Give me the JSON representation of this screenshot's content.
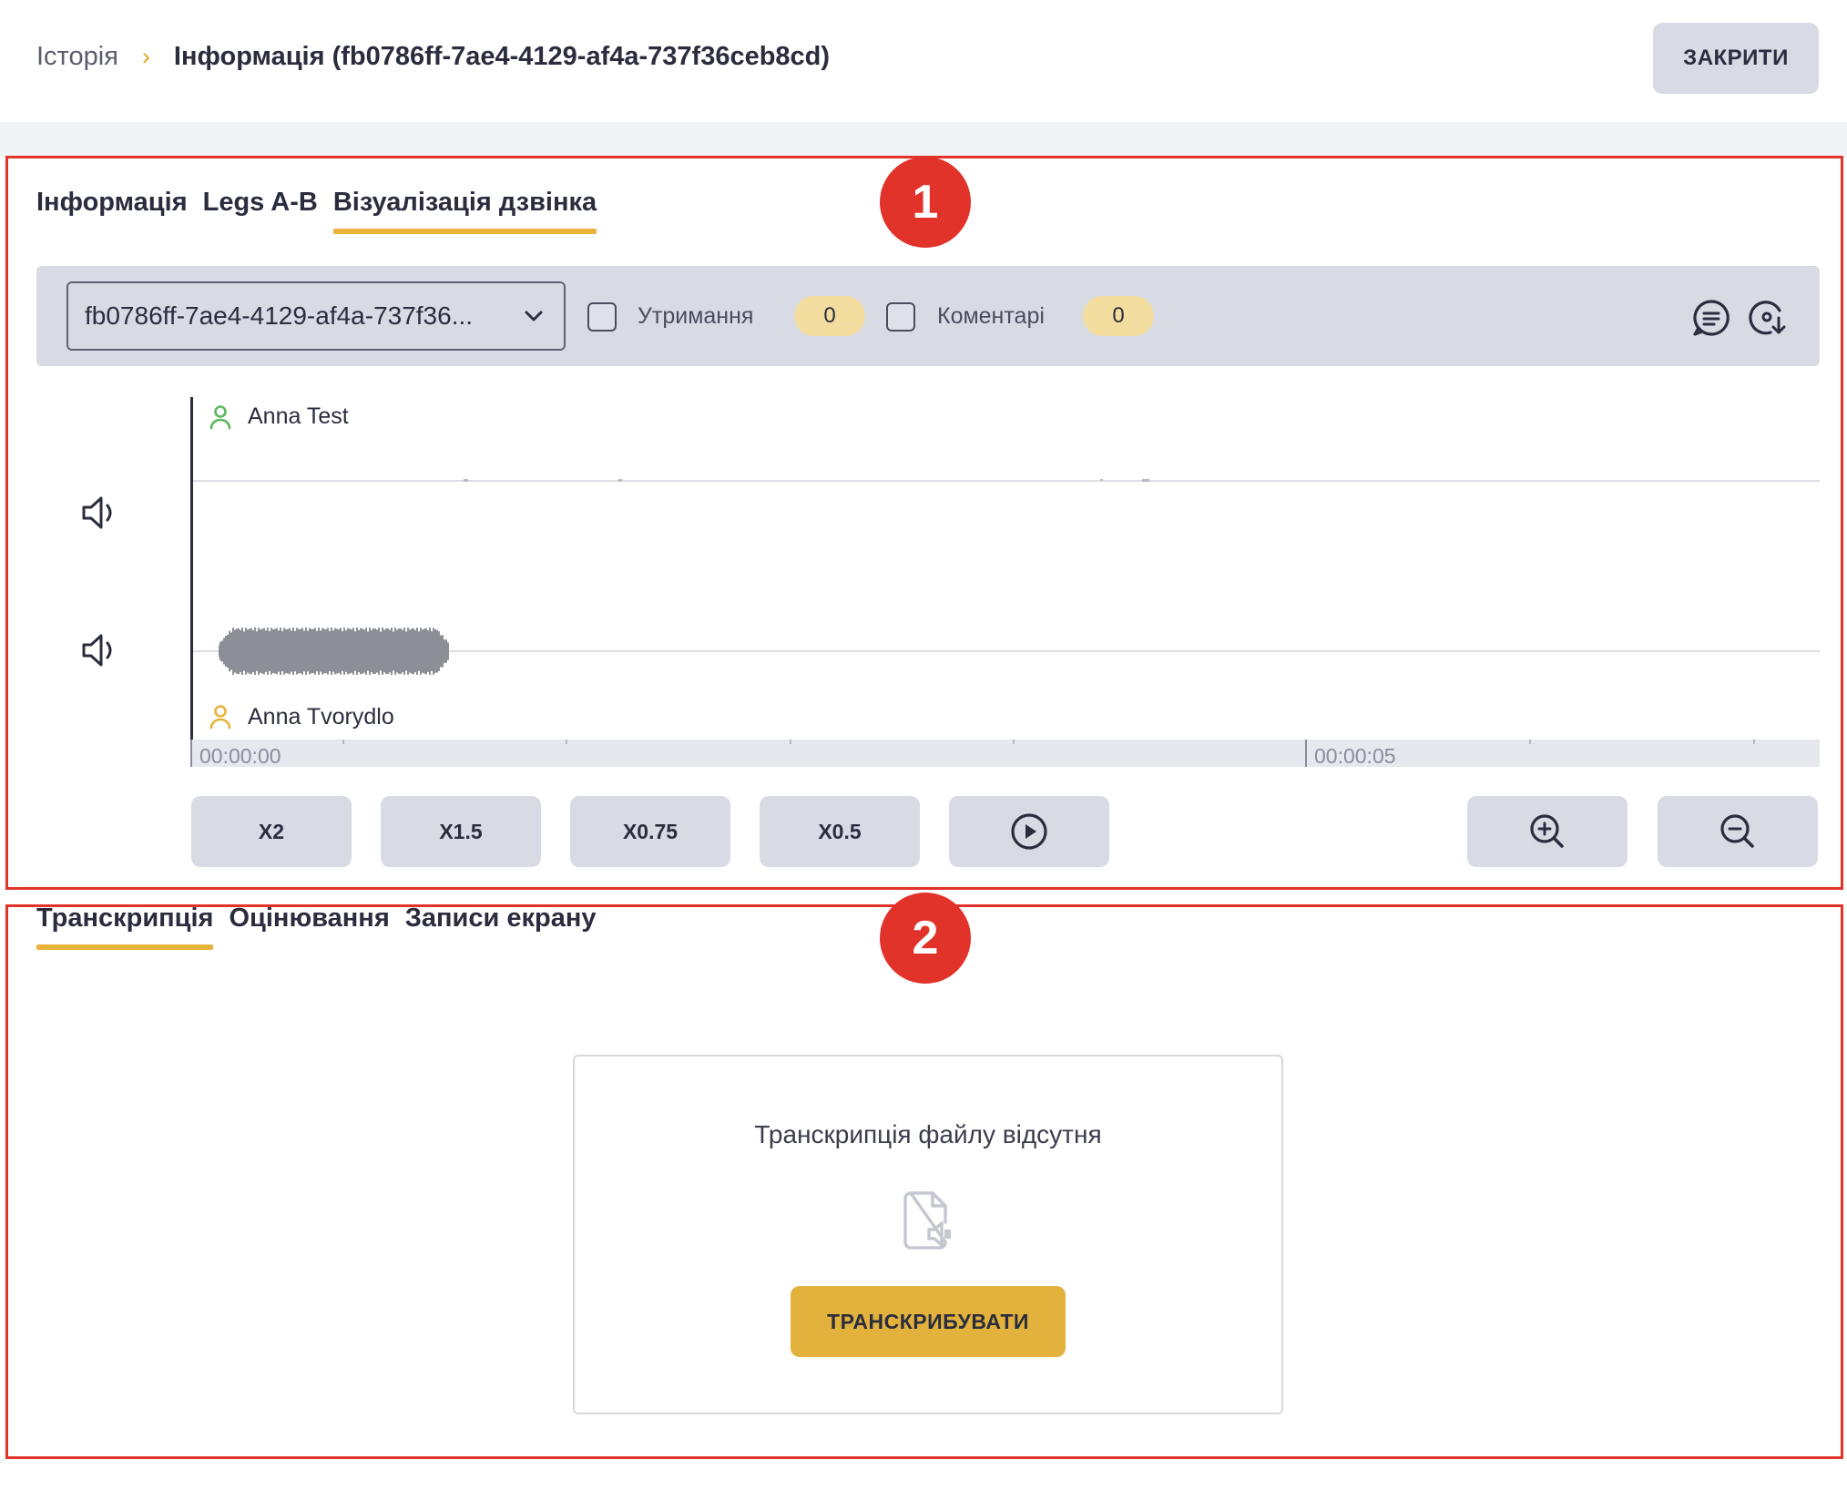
{
  "header": {
    "breadcrumb": {
      "history": "Історія",
      "separator": "›",
      "current": "Інформація (fb0786ff-7ae4-4129-af4a-737f36ceb8cd)"
    },
    "close_label": "ЗАКРИТИ"
  },
  "annotations": {
    "badge_1": "1",
    "badge_2": "2"
  },
  "top_tabs": [
    {
      "label": "Інформація",
      "active": false
    },
    {
      "label": "Legs A-B",
      "active": false
    },
    {
      "label": "Візуалізація дзвінка",
      "active": true
    }
  ],
  "toolbar": {
    "recording_value": "fb0786ff-7ae4-4129-af4a-737f36...",
    "hold_label": "Утримання",
    "hold_count": "0",
    "comments_label": "Коментарі",
    "comments_count": "0"
  },
  "waveform": {
    "speaker_a": "Anna Test",
    "speaker_b": "Anna Tvorydlo",
    "timeline": [
      "00:00:00",
      "00:00:05"
    ]
  },
  "controls": {
    "speeds": [
      "X2",
      "X1.5",
      "X0.75",
      "X0.5"
    ]
  },
  "bottom_tabs": [
    {
      "label": "Транскрипція",
      "active": true
    },
    {
      "label": "Оцінювання",
      "active": false
    },
    {
      "label": "Записи екрану",
      "active": false
    }
  ],
  "transcription": {
    "empty_text": "Транскрипція файлу відсутня",
    "button_label": "ТРАНСКРИБУВАТИ"
  },
  "colors": {
    "accent": "#e8b33a",
    "button_bg": "#d8dbe4",
    "annotation_red": "#e2332b",
    "primary_button": "#e3b23c",
    "speaker_a_icon": "#5cb85c",
    "speaker_b_icon": "#e8b33a"
  },
  "icons": {
    "chat": "chat-icon",
    "download": "download-icon",
    "speaker": "speaker-icon",
    "user": "user-icon",
    "play": "play-icon",
    "zoom_in": "zoom-in-icon",
    "zoom_out": "zoom-out-icon",
    "file_audio": "file-audio-icon",
    "chevron": "chevron-down-icon"
  }
}
